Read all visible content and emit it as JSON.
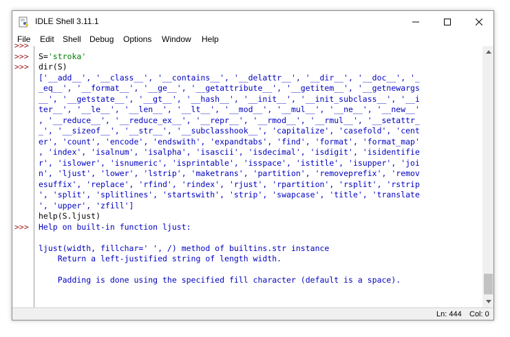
{
  "window": {
    "title": "IDLE Shell 3.11.1"
  },
  "menu": [
    "File",
    "Edit",
    "Shell",
    "Debug",
    "Options",
    "Window",
    "Help"
  ],
  "prompts": [
    {
      "line": 0,
      "text": ">>>"
    },
    {
      "line": 1,
      "text": ">>>"
    },
    {
      "line": 2,
      "text": ">>>"
    },
    {
      "line": 17,
      "text": ">>>"
    }
  ],
  "lines": [
    {
      "type": "input",
      "text": ""
    },
    {
      "type": "input",
      "parts": [
        {
          "t": "S=",
          "c": "input"
        },
        {
          "t": "'stroka'",
          "c": "str"
        }
      ]
    },
    {
      "type": "input",
      "text": "dir(S)"
    },
    {
      "type": "out",
      "text": "['__add__', '__class__', '__contains__', '__delattr__', '__dir__', '__doc__', '_"
    },
    {
      "type": "out",
      "text": "_eq__', '__format__', '__ge__', '__getattribute__', '__getitem__', '__getnewargs"
    },
    {
      "type": "out",
      "text": "__', '__getstate__', '__gt__', '__hash__', '__init__', '__init_subclass__', '__i"
    },
    {
      "type": "out",
      "text": "ter__', '__le__', '__len__', '__lt__', '__mod__', '__mul__', '__ne__', '__new__'"
    },
    {
      "type": "out",
      "text": ", '__reduce__', '__reduce_ex__', '__repr__', '__rmod__', '__rmul__', '__setattr_"
    },
    {
      "type": "out",
      "text": "_', '__sizeof__', '__str__', '__subclasshook__', 'capitalize', 'casefold', 'cent"
    },
    {
      "type": "out",
      "text": "er', 'count', 'encode', 'endswith', 'expandtabs', 'find', 'format', 'format_map'"
    },
    {
      "type": "out",
      "text": ", 'index', 'isalnum', 'isalpha', 'isascii', 'isdecimal', 'isdigit', 'isidentifie"
    },
    {
      "type": "out",
      "text": "r', 'islower', 'isnumeric', 'isprintable', 'isspace', 'istitle', 'isupper', 'joi"
    },
    {
      "type": "out",
      "text": "n', 'ljust', 'lower', 'lstrip', 'maketrans', 'partition', 'removeprefix', 'remov"
    },
    {
      "type": "out",
      "text": "esuffix', 'replace', 'rfind', 'rindex', 'rjust', 'rpartition', 'rsplit', 'rstrip"
    },
    {
      "type": "out",
      "text": "', 'split', 'splitlines', 'startswith', 'strip', 'swapcase', 'title', 'translate"
    },
    {
      "type": "out",
      "text": "', 'upper', 'zfill']"
    },
    {
      "type": "input",
      "text": "help(S.ljust)"
    },
    {
      "type": "out",
      "text": "Help on built-in function ljust:"
    },
    {
      "type": "out",
      "text": ""
    },
    {
      "type": "out",
      "text": "ljust(width, fillchar=' ', /) method of builtins.str instance"
    },
    {
      "type": "out",
      "text": "    Return a left-justified string of length width."
    },
    {
      "type": "out",
      "text": ""
    },
    {
      "type": "out",
      "text": "    Padding is done using the specified fill character (default is a space)."
    }
  ],
  "status": {
    "ln": "Ln: 444",
    "col": "Col: 0"
  },
  "colors": {
    "prompt": "#a01a1a",
    "output": "#0000c0",
    "string": "#008000",
    "input": "#000000"
  }
}
